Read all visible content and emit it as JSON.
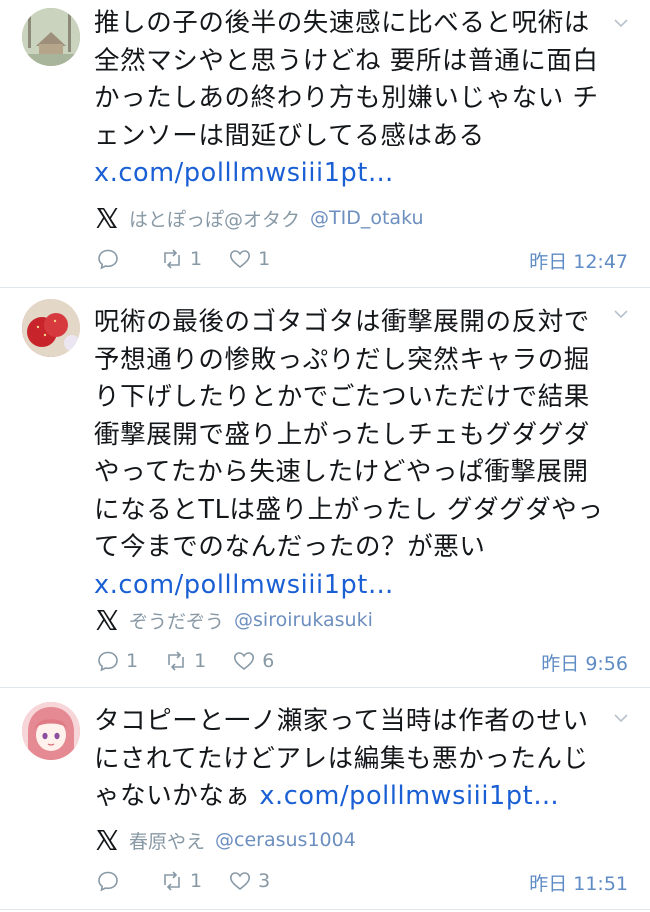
{
  "posts": [
    {
      "text": "推しの子の後半の失速感に比べると呪術は全然マシやと思うけどね 要所は普通に面白かったしあの終わり方も別嫌いじゃない チェンソーは間延びしてる感はある\n",
      "link": "x.com/polllmwsiii1pt…",
      "source_name": "はとぽっぽ@オタク",
      "source_handle": "@TID_otaku",
      "reply_count": "",
      "repost_count": "1",
      "like_count": "1",
      "time": "昨日 12:47"
    },
    {
      "text": "呪術の最後のゴタゴタは衝撃展開の反対で予想通りの惨敗っぷりだし突然キャラの掘り下げしたりとかでごたついただけで結果衝撃展開で盛り上がったしチェもグダグダやってたから失速したけどやっぱ衝撃展開になるとTLは盛り上がったし グダグダやって今までのなんだったの？が悪い\n",
      "link": "x.com/polllmwsiii1pt…",
      "source_name": "ぞうだぞう",
      "source_handle": "@siroirukasuki",
      "reply_count": "1",
      "repost_count": "1",
      "like_count": "6",
      "time": "昨日 9:56"
    },
    {
      "text": "タコピーと一ノ瀬家って当時は作者のせいにされてたけどアレは編集も悪かったんじゃないかなぁ ",
      "link": "x.com/polllmwsiii1pt…",
      "source_name": "春原やえ",
      "source_handle": "@cerasus1004",
      "reply_count": "",
      "repost_count": "1",
      "like_count": "3",
      "time": "昨日 11:51"
    }
  ],
  "icons": {
    "more": "chevron-down-icon",
    "source": "x-logo-icon",
    "reply": "reply-icon",
    "repost": "repost-icon",
    "like": "heart-icon"
  },
  "colors": {
    "link": "#1a5fd4",
    "handle": "#6d8fbf",
    "meta": "#8899a6",
    "time": "#5f8cc4",
    "divider": "#e1e8ed"
  }
}
